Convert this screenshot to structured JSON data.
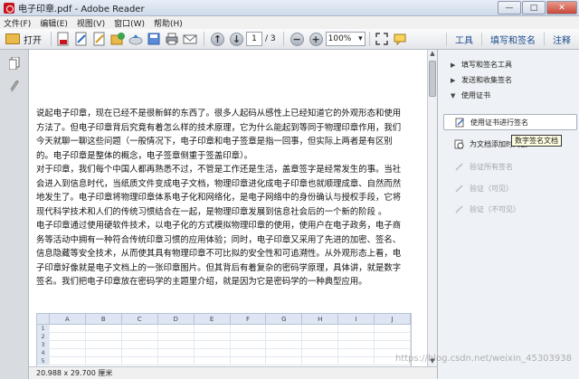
{
  "window": {
    "title": "电子印章.pdf - Adobe Reader",
    "controls": [
      "—",
      "□",
      "✕"
    ]
  },
  "menu": [
    "文件(F)",
    "编辑(E)",
    "视图(V)",
    "窗口(W)",
    "帮助(H)"
  ],
  "toolbar": {
    "open_label": "打开",
    "page_current": "1",
    "page_total": "/ 3",
    "zoom_value": "100%",
    "right_tabs": [
      "工具",
      "填写和签名",
      "注释"
    ]
  },
  "document": {
    "paragraphs": [
      "说起电子印章，现在已经不是很新鲜的东西了。很多人起码从感性上已经知道它的外观形态和使用方法了。但电子印章背后究竟有着怎么样的技术原理，它为什么能起到等同于物理印章作用，我们今天就聊一聊这些问题（一般情况下，电子印章和电子签章是指一回事，但实际上两者是有区别的。电子印章是整体的概念，电子签章侧重于签盖印章）。",
      "对于印章，我们每个中国人都再熟悉不过，不管是工作还是生活，盖章签字是经常发生的事。当社会进入到信息时代，当纸质文件变成电子文档，物理印章进化成电子印章也就顺理成章、自然而然地发生了。电子印章将物理印章体系电子化和网络化，是电子网络中的身份确认与授权手段，它将现代科学技术和人们的传统习惯结合在一起，是物理印章发展到信息社会后的一个新的阶段 。",
      "电子印章通过使用硬软件技术，以电子化的方式模拟物理印章的使用，使用户在电子政务，电子商务等活动中拥有一种符合传统印章习惯的应用体验；同时，电子印章又采用了先进的加密、签名、信息隐藏等安全技术，从而使其具有物理印章不可比拟的安全性和可追溯性。从外观形态上看，电子印章好像就是电子文档上的一张印章图片。但其背后有着复杂的密码学原理，具体讲，就是数字签名。我们把电子印章放在密码学的主题里介绍，就是因为它是密码学的一种典型应用。"
    ],
    "sheet": {
      "columns": [
        "A",
        "B",
        "C",
        "D",
        "E",
        "F",
        "G",
        "H",
        "I",
        "J"
      ],
      "rows": [
        "1",
        "2",
        "3",
        "4",
        "5"
      ]
    }
  },
  "statusbar": {
    "page_size": "20.988 x 29.700 厘米"
  },
  "right_panel": {
    "sections": [
      "填写和签名工具",
      "发送和收集签名",
      "使用证书"
    ],
    "items": [
      {
        "label": "使用证书进行签名",
        "enabled": true
      },
      {
        "label": "为文档添加时间戳",
        "enabled": true
      },
      {
        "label": "验证所有签名",
        "enabled": false
      },
      {
        "label": "验证（可见）",
        "enabled": false
      },
      {
        "label": "验证（不可见）",
        "enabled": false
      }
    ],
    "tooltip": "数字签名文档"
  },
  "watermark": "https://blog.csdn.net/weixin_45303938"
}
